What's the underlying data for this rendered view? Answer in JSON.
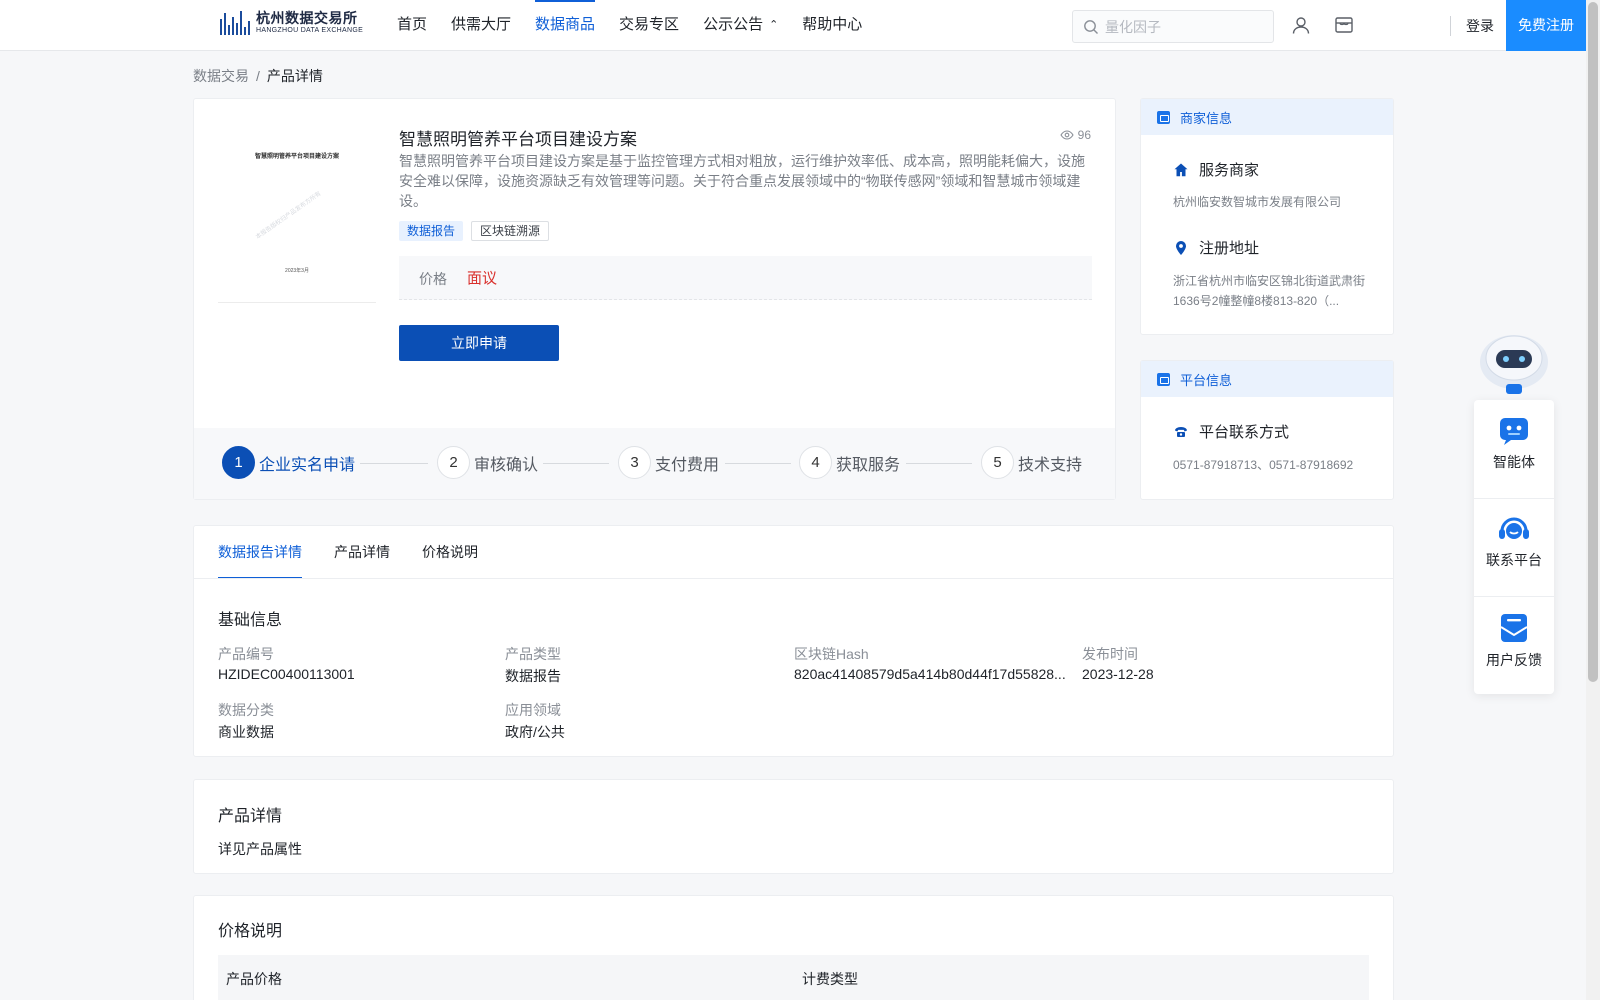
{
  "header": {
    "logo_cn": "杭州数据交易所",
    "logo_en": "HANGZHOU DATA EXCHANGE",
    "nav": [
      {
        "label": "首页"
      },
      {
        "label": "供需大厅"
      },
      {
        "label": "数据商品"
      },
      {
        "label": "交易专区"
      },
      {
        "label": "公示公告"
      },
      {
        "label": "帮助中心"
      }
    ],
    "active_nav": "数据商品",
    "search_placeholder": "量化因子",
    "login": "登录",
    "register": "免费注册"
  },
  "breadcrumb": {
    "root": "数据交易",
    "separator": "/",
    "current": "产品详情"
  },
  "product": {
    "cover_title": "智慧照明管养平台项目建设方案",
    "cover_watermark": "本报告版权归产品发布方所有",
    "cover_date": "2023年3月",
    "title": "智慧照明管养平台项目建设方案",
    "views": "96",
    "description": "智慧照明管养平台项目建设方案是基于监控管理方式相对粗放，运行维护效率低、成本高，照明能耗偏大，设施安全难以保障，设施资源缺乏有效管理等问题。关于符合重点发展领域中的“物联传感网”领域和智慧城市领域建设。",
    "tags": [
      "数据报告",
      "区块链溯源"
    ],
    "price_label": "价格",
    "price_value": "面议",
    "apply_button": "立即申请",
    "steps": [
      {
        "num": "1",
        "label": "企业实名申请"
      },
      {
        "num": "2",
        "label": "审核确认"
      },
      {
        "num": "3",
        "label": "支付费用"
      },
      {
        "num": "4",
        "label": "获取服务"
      },
      {
        "num": "5",
        "label": "技术支持"
      }
    ]
  },
  "merchant": {
    "header": "商家信息",
    "service_label": "服务商家",
    "service_value": "杭州临安数智城市发展有限公司",
    "address_label": "注册地址",
    "address_value": "浙江省杭州市临安区锦北街道武肃街1636号2幢整幢8楼813-820（..."
  },
  "platform": {
    "header": "平台信息",
    "contact_label": "平台联系方式",
    "contact_value": "0571-87918713、0571-87918692"
  },
  "tabs": [
    {
      "label": "数据报告详情"
    },
    {
      "label": "产品详情"
    },
    {
      "label": "价格说明"
    }
  ],
  "basic_info": {
    "title": "基础信息",
    "fields": [
      {
        "label": "产品编号",
        "value": "HZIDEC00400113001"
      },
      {
        "label": "产品类型",
        "value": "数据报告"
      },
      {
        "label": "区块链Hash",
        "value": "820ac41408579d5a414b80d44f17d55828..."
      },
      {
        "label": "发布时间",
        "value": "2023-12-28"
      },
      {
        "label": "数据分类",
        "value": "商业数据"
      },
      {
        "label": "应用领域",
        "value": "政府/公共"
      }
    ]
  },
  "product_detail": {
    "title": "产品详情",
    "text": "详见产品属性"
  },
  "price_section": {
    "title": "价格说明",
    "columns": [
      "产品价格",
      "计费类型"
    ]
  },
  "float_panel": {
    "items": [
      {
        "label": "智能体",
        "icon": "robot-chat-icon"
      },
      {
        "label": "联系平台",
        "icon": "headset-icon"
      },
      {
        "label": "用户反馈",
        "icon": "feedback-mail-icon"
      }
    ]
  },
  "colors": {
    "primary": "#0b4fb5",
    "accent": "#0f5fd7",
    "register_bg": "#1a8cff",
    "price": "#d9302c"
  }
}
